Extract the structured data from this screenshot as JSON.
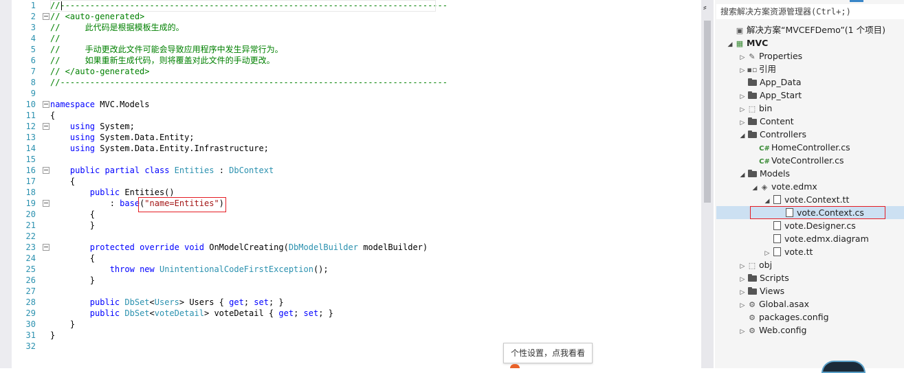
{
  "editor": {
    "lines": [
      {
        "n": "1",
        "fold": false,
        "html": "<span class=\"c\">//------------------------------------------------------------------------------</span>"
      },
      {
        "n": "2",
        "fold": true,
        "html": "<span class=\"c\">// &lt;auto-generated&gt;</span>"
      },
      {
        "n": "3",
        "fold": false,
        "html": "<span class=\"c\">//     此代码是根据模板生成的。</span>"
      },
      {
        "n": "4",
        "fold": false,
        "html": "<span class=\"c\">//</span>"
      },
      {
        "n": "5",
        "fold": false,
        "html": "<span class=\"c\">//     手动更改此文件可能会导致应用程序中发生异常行为。</span>"
      },
      {
        "n": "6",
        "fold": false,
        "html": "<span class=\"c\">//     如果重新生成代码，则将覆盖对此文件的手动更改。</span>"
      },
      {
        "n": "7",
        "fold": false,
        "html": "<span class=\"c\">// &lt;/auto-generated&gt;</span>"
      },
      {
        "n": "8",
        "fold": false,
        "html": "<span class=\"c\">//------------------------------------------------------------------------------</span>"
      },
      {
        "n": "9",
        "fold": false,
        "html": ""
      },
      {
        "n": "10",
        "fold": true,
        "html": "<span class=\"k\">namespace</span> MVC.Models"
      },
      {
        "n": "11",
        "fold": false,
        "html": "{"
      },
      {
        "n": "12",
        "fold": true,
        "html": "    <span class=\"k\">using</span> System;"
      },
      {
        "n": "13",
        "fold": false,
        "html": "    <span class=\"k\">using</span> System.Data.Entity;"
      },
      {
        "n": "14",
        "fold": false,
        "html": "    <span class=\"k\">using</span> System.Data.Entity.Infrastructure;"
      },
      {
        "n": "15",
        "fold": false,
        "html": ""
      },
      {
        "n": "16",
        "fold": true,
        "html": "    <span class=\"k\">public</span> <span class=\"k\">partial</span> <span class=\"k\">class</span> <span class=\"t\">Entities</span> : <span class=\"t\">DbContext</span>"
      },
      {
        "n": "17",
        "fold": false,
        "html": "    {"
      },
      {
        "n": "18",
        "fold": false,
        "html": "        <span class=\"k\">public</span> Entities()"
      },
      {
        "n": "19",
        "fold": true,
        "html": "            : <span class=\"k\">base</span>(<span class=\"s\">\"name=Entities\"</span>)"
      },
      {
        "n": "20",
        "fold": false,
        "html": "        {"
      },
      {
        "n": "21",
        "fold": false,
        "html": "        }"
      },
      {
        "n": "22",
        "fold": false,
        "html": ""
      },
      {
        "n": "23",
        "fold": true,
        "html": "        <span class=\"k\">protected</span> <span class=\"k\">override</span> <span class=\"k\">void</span> OnModelCreating(<span class=\"t\">DbModelBuilder</span> modelBuilder)"
      },
      {
        "n": "24",
        "fold": false,
        "html": "        {"
      },
      {
        "n": "25",
        "fold": false,
        "html": "            <span class=\"k\">throw</span> <span class=\"k\">new</span> <span class=\"t\">UnintentionalCodeFirstException</span>();"
      },
      {
        "n": "26",
        "fold": false,
        "html": "        }"
      },
      {
        "n": "27",
        "fold": false,
        "html": ""
      },
      {
        "n": "28",
        "fold": false,
        "html": "        <span class=\"k\">public</span> <span class=\"t\">DbSet</span>&lt;<span class=\"t\">Users</span>&gt; Users { <span class=\"k\">get</span>; <span class=\"k\">set</span>; }"
      },
      {
        "n": "29",
        "fold": false,
        "html": "        <span class=\"k\">public</span> <span class=\"t\">DbSet</span>&lt;<span class=\"t\">voteDetail</span>&gt; voteDetail { <span class=\"k\">get</span>; <span class=\"k\">set</span>; }"
      },
      {
        "n": "30",
        "fold": false,
        "html": "    }"
      },
      {
        "n": "31",
        "fold": false,
        "html": "}"
      },
      {
        "n": "32",
        "fold": false,
        "html": ""
      }
    ]
  },
  "solution_explorer": {
    "search_placeholder": "搜索解决方案资源管理器(Ctrl+;)",
    "items": [
      {
        "label": "解决方案“MVCEFDemo”(1 个项目)",
        "indent": 0,
        "arrow": "",
        "icon": "solution",
        "bold": false
      },
      {
        "label": "MVC",
        "indent": 0,
        "arrow": "◢",
        "icon": "project",
        "bold": true
      },
      {
        "label": "Properties",
        "indent": 1,
        "arrow": "▷",
        "icon": "wrench",
        "bold": false
      },
      {
        "label": "引用",
        "indent": 1,
        "arrow": "▷",
        "icon": "refs",
        "bold": false
      },
      {
        "label": "App_Data",
        "indent": 1,
        "arrow": "",
        "icon": "folder",
        "bold": false
      },
      {
        "label": "App_Start",
        "indent": 1,
        "arrow": "▷",
        "icon": "folder",
        "bold": false
      },
      {
        "label": "bin",
        "indent": 1,
        "arrow": "▷",
        "icon": "dotted",
        "bold": false
      },
      {
        "label": "Content",
        "indent": 1,
        "arrow": "▷",
        "icon": "folder",
        "bold": false
      },
      {
        "label": "Controllers",
        "indent": 1,
        "arrow": "◢",
        "icon": "folder",
        "bold": false
      },
      {
        "label": "HomeController.cs",
        "indent": 2,
        "arrow": "",
        "icon": "cs",
        "bold": false
      },
      {
        "label": "VoteController.cs",
        "indent": 2,
        "arrow": "",
        "icon": "cs",
        "bold": false
      },
      {
        "label": "Models",
        "indent": 1,
        "arrow": "◢",
        "icon": "folder",
        "bold": false
      },
      {
        "label": "vote.edmx",
        "indent": 2,
        "arrow": "◢",
        "icon": "edmx",
        "bold": false
      },
      {
        "label": "vote.Context.tt",
        "indent": 3,
        "arrow": "◢",
        "icon": "file",
        "bold": false
      },
      {
        "label": "vote.Context.cs",
        "indent": 4,
        "arrow": "",
        "icon": "file",
        "bold": false
      },
      {
        "label": "vote.Designer.cs",
        "indent": 3,
        "arrow": "",
        "icon": "file",
        "bold": false
      },
      {
        "label": "vote.edmx.diagram",
        "indent": 3,
        "arrow": "",
        "icon": "file",
        "bold": false
      },
      {
        "label": "vote.tt",
        "indent": 3,
        "arrow": "▷",
        "icon": "file",
        "bold": false
      },
      {
        "label": "obj",
        "indent": 1,
        "arrow": "▷",
        "icon": "dotted",
        "bold": false
      },
      {
        "label": "Scripts",
        "indent": 1,
        "arrow": "▷",
        "icon": "folder",
        "bold": false
      },
      {
        "label": "Views",
        "indent": 1,
        "arrow": "▷",
        "icon": "folder",
        "bold": false
      },
      {
        "label": "Global.asax",
        "indent": 1,
        "arrow": "▷",
        "icon": "gear",
        "bold": false
      },
      {
        "label": "packages.config",
        "indent": 1,
        "arrow": "",
        "icon": "config",
        "bold": false
      },
      {
        "label": "Web.config",
        "indent": 1,
        "arrow": "▷",
        "icon": "config",
        "bold": false
      }
    ]
  },
  "tooltip": {
    "text": "个性设置，点我看看"
  },
  "scrollbar": {
    "split_glyph": "⸗"
  }
}
